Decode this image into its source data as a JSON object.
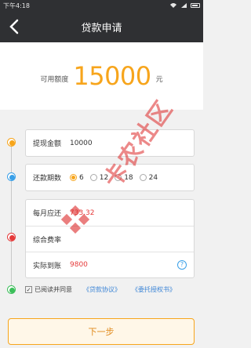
{
  "status": {
    "time": "下午4:18"
  },
  "header": {
    "title": "贷款申请"
  },
  "credit": {
    "label": "可用额度",
    "amount": "15000",
    "unit": "元"
  },
  "withdraw": {
    "label": "提现金额",
    "value": "10000"
  },
  "terms": {
    "label": "还款期数",
    "options": [
      "6",
      "12",
      "18",
      "24"
    ],
    "selected": "6"
  },
  "summary": {
    "monthly_label": "每月应还",
    "monthly_value": "733.32",
    "fee_label": "综合费率",
    "fee_value": "",
    "actual_label": "实际到账",
    "actual_value": "9800"
  },
  "agreement": {
    "text": "已阅读并同意",
    "link1": "《贷款协议》",
    "link2": "《委托授权书》"
  },
  "footer": {
    "next_label": "下一步"
  },
  "watermark": {
    "text": "卡农社区"
  },
  "colors": {
    "accent": "#f7a51c",
    "danger": "#e53a3a",
    "link": "#3a84d6",
    "bar": "#2f3033"
  }
}
